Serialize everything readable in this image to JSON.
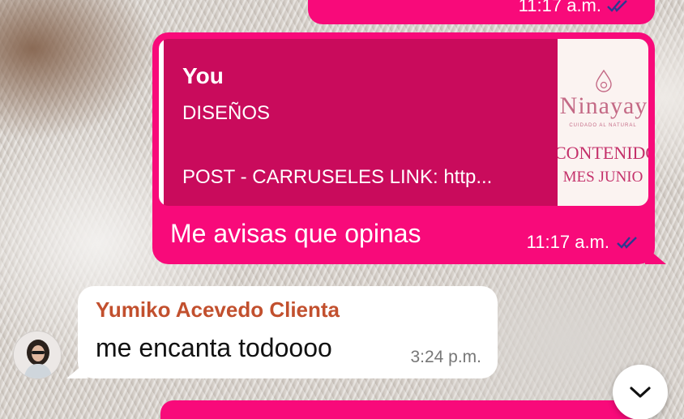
{
  "messages": {
    "top": {
      "time": "11:17 a.m."
    },
    "main": {
      "quote_author": "You",
      "quote_title": "DISEÑOS",
      "quote_text": "POST - CARRUSELES LINK: http...",
      "thumbnail": {
        "brand": "Ninayay",
        "tagline": "CUIDADO AL NATURAL",
        "line1": "CONTENIDO",
        "line2": "MES JUNIO"
      },
      "text": "Me avisas que opinas",
      "time": "11:17 a.m."
    },
    "incoming": {
      "sender": "Yumiko Acevedo Clienta",
      "text": "me encanta todoooo",
      "time": "3:24 p.m."
    },
    "bottom": {
      "text": ""
    }
  },
  "colors": {
    "outgoing_bubble": "#f80a7a",
    "quote_bg": "#c90b5c",
    "sender_name": "#c2502e",
    "read_ticks": "#2b3a8f"
  },
  "icons": {
    "read_receipt": "double-check-icon",
    "scroll_down": "chevron-down-icon"
  }
}
